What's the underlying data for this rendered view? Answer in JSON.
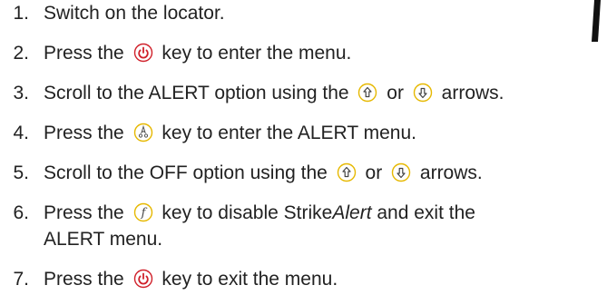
{
  "steps": [
    {
      "num": "1.",
      "parts": [
        "Switch on the locator."
      ]
    },
    {
      "num": "2.",
      "a": "Press the",
      "icon": "power-icon",
      "b": "key to enter the menu."
    },
    {
      "num": "3.",
      "a": "Scroll to the ALERT option using the",
      "icon1": "up-arrow-icon",
      "mid": "or",
      "icon2": "down-arrow-icon",
      "b": "arrows."
    },
    {
      "num": "4.",
      "a": "Press the",
      "icon": "alert-icon",
      "b": "key to enter the ALERT menu."
    },
    {
      "num": "5.",
      "a": "Scroll to the OFF option using the",
      "icon1": "up-arrow-icon",
      "mid": "or",
      "icon2": "down-arrow-icon",
      "b": "arrows."
    },
    {
      "num": "6.",
      "a": "Press the",
      "icon": "function-icon",
      "b1": "key to disable Strike",
      "b_italic": "Alert",
      "b2": "and exit the",
      "line2": "ALERT menu."
    },
    {
      "num": "7.",
      "a": "Press the",
      "icon": "power-icon",
      "b": "key to exit the menu."
    }
  ],
  "colors": {
    "power": "#d0202a",
    "icon_stroke": "#555555",
    "text": "#222222"
  }
}
